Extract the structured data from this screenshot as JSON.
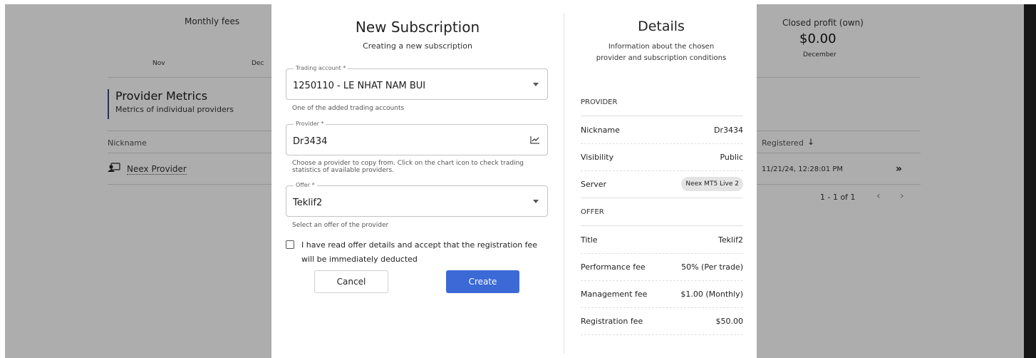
{
  "background": {
    "monthly_fees_label": "Monthly fees",
    "month_nov": "Nov",
    "month_dec": "Dec",
    "closed_profit_label": "Closed profit (own)",
    "closed_profit_value": "$0.00",
    "closed_profit_period": "December",
    "metrics_title": "Provider Metrics",
    "metrics_subtitle": "Metrics of individual providers",
    "col_nickname": "Nickname",
    "col_registered": "Registered",
    "row_nickname": "Neex Provider",
    "row_registered": "11/21/24, 12:28:01 PM",
    "pagination": "1 - 1 of 1"
  },
  "modal": {
    "title": "New Subscription",
    "subtitle": "Creating a new subscription",
    "trading_account": {
      "label": "Trading account *",
      "value": "1250110 - LE NHAT NAM BUI",
      "helper": "One of the added trading accounts"
    },
    "provider": {
      "label": "Provider *",
      "value": "Dr3434",
      "helper": "Choose a provider to copy from. Click on the chart icon to check trading statistics of available providers."
    },
    "offer": {
      "label": "Offer *",
      "value": "Teklif2",
      "helper": "Select an offer of the provider"
    },
    "accept_label": "I have read offer details and accept that the registration fee will be immediately deducted",
    "cancel_label": "Cancel",
    "create_label": "Create",
    "primary_color": "#3b69d6"
  },
  "details": {
    "title": "Details",
    "subtitle": "Information about the chosen provider and subscription conditions",
    "provider_section": "PROVIDER",
    "nickname_label": "Nickname",
    "nickname_value": "Dr3434",
    "visibility_label": "Visibility",
    "visibility_value": "Public",
    "server_label": "Server",
    "server_value": "Neex MT5 Live 2",
    "offer_section": "OFFER",
    "title_label": "Title",
    "title_value": "Teklif2",
    "performance_label": "Performance fee",
    "performance_value": "50% (Per trade)",
    "management_label": "Management fee",
    "management_value": "$1.00 (Monthly)",
    "registration_label": "Registration fee",
    "registration_value": "$50.00"
  },
  "icons": {
    "dropdown": "chevron-down-icon",
    "chart": "chart-icon",
    "provider": "provider-avatar-icon",
    "sort": "arrow-down-icon",
    "row_action": "double-chevron-right-icon",
    "prev_page": "chevron-left-icon",
    "next_page": "chevron-right-icon"
  }
}
